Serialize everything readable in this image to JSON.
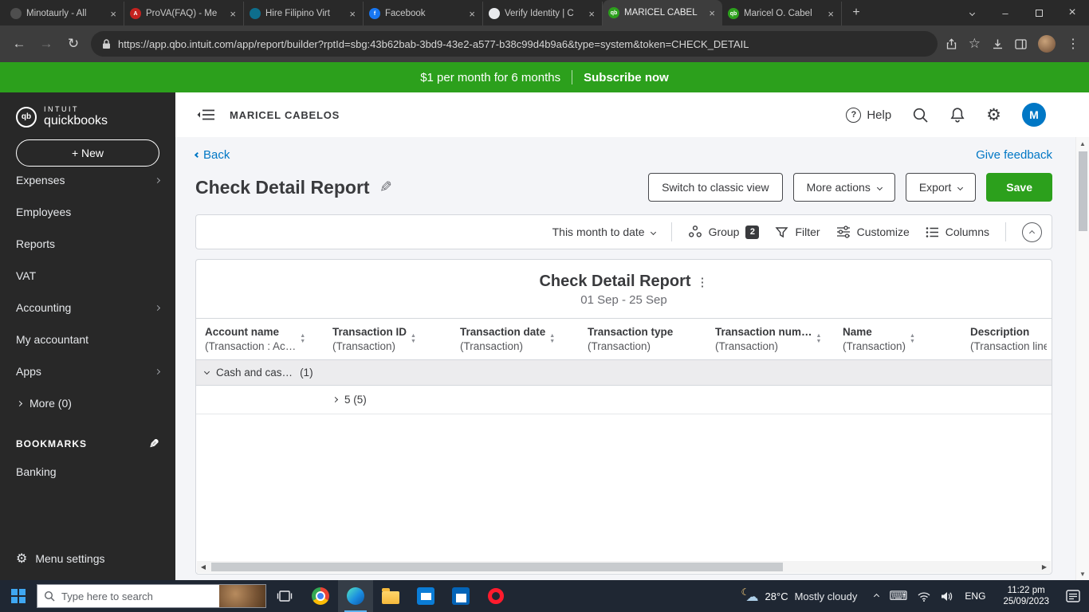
{
  "browser": {
    "tabs": [
      {
        "label": "Minotaurly - All",
        "icon": "minotaurly",
        "icon_letter": "",
        "color": "#4e4e4e"
      },
      {
        "label": "ProVA(FAQ) - Me",
        "icon": "prova",
        "icon_letter": "A",
        "color": "#c5221f"
      },
      {
        "label": "Hire Filipino Virt",
        "icon": "hire-filipino",
        "icon_letter": "",
        "color": "#0e6e8c"
      },
      {
        "label": "Facebook",
        "icon": "facebook",
        "icon_letter": "f",
        "color": "#1877f2"
      },
      {
        "label": "Verify Identity | C",
        "icon": "verify-identity",
        "icon_letter": "",
        "color": "#e8eaed"
      },
      {
        "label": "MARICEL CABEL",
        "icon": "quickbooks",
        "icon_letter": "qb",
        "color": "#2ca01c"
      },
      {
        "label": "Maricel O. Cabel",
        "icon": "quickbooks",
        "icon_letter": "qb",
        "color": "#2ca01c"
      }
    ],
    "url": "https://app.qbo.intuit.com/app/report/builder?rptId=sbg:43b62bab-3bd9-43e2-a577-b38c99d4b9a6&type=system&token=CHECK_DETAIL"
  },
  "banner": {
    "text": "$1 per month for 6 months",
    "cta": "Subscribe now"
  },
  "sidebar": {
    "logo_mark": "qb",
    "logo_top": "INTUIT",
    "logo_bottom": "quickbooks",
    "new_button": "+ New",
    "items": [
      {
        "label": "Expenses",
        "chevron": true
      },
      {
        "label": "Employees",
        "chevron": false
      },
      {
        "label": "Reports",
        "chevron": false
      },
      {
        "label": "VAT",
        "chevron": false
      },
      {
        "label": "Accounting",
        "chevron": true
      },
      {
        "label": "My accountant",
        "chevron": false
      },
      {
        "label": "Apps",
        "chevron": true
      },
      {
        "label": "More (0)",
        "chevron": false
      }
    ],
    "bookmarks_label": "BOOKMARKS",
    "bookmarks": [
      {
        "label": "Banking"
      }
    ],
    "menu_settings": "Menu settings"
  },
  "header": {
    "company": "MARICEL CABELOS",
    "help": "Help",
    "avatar": "M"
  },
  "page": {
    "back": "Back",
    "feedback": "Give feedback",
    "title": "Check Detail Report",
    "actions": {
      "classic": "Switch to classic view",
      "more": "More actions",
      "export": "Export",
      "save": "Save"
    }
  },
  "toolbar": {
    "date_range": "This month to date",
    "group": "Group",
    "group_badge": "2",
    "filter": "Filter",
    "customize": "Customize",
    "columns": "Columns"
  },
  "report": {
    "title": "Check Detail Report",
    "subtitle": "01 Sep - 25 Sep",
    "columns": [
      {
        "name": "Account name",
        "sub": "(Transaction : Ac…",
        "sortable": true
      },
      {
        "name": "Transaction ID",
        "sub": "(Transaction)",
        "sortable": true
      },
      {
        "name": "Transaction date",
        "sub": "(Transaction)",
        "sortable": true
      },
      {
        "name": "Transaction type",
        "sub": "(Transaction)",
        "sortable": false
      },
      {
        "name": "Transaction num…",
        "sub": "(Transaction)",
        "sortable": true
      },
      {
        "name": "Name",
        "sub": "(Transaction)",
        "sortable": true
      },
      {
        "name": "Description",
        "sub": "(Transaction line",
        "sortable": false
      }
    ],
    "group_row": {
      "label": "Cash and cas…",
      "count": "(1)"
    },
    "sub_row": {
      "label": "5 (5)"
    }
  },
  "taskbar": {
    "search_placeholder": "Type here to search",
    "weather_temp": "28°C",
    "weather_desc": "Mostly cloudy",
    "lang": "ENG",
    "time": "11:22 pm",
    "date": "25/09/2023"
  },
  "colors": {
    "accent_green": "#2ca01c",
    "link_blue": "#0077c5"
  },
  "icons": {
    "close": "×",
    "plus": "+",
    "minimize": "–",
    "back": "←",
    "forward": "→",
    "reload": "↻",
    "star": "☆",
    "menu_dots": "⋮",
    "kebab": "⋮",
    "gear": "⚙",
    "question": "?",
    "pencil": "✎",
    "sort_up": "▲",
    "sort_down": "▼",
    "keyboard": "⌨",
    "cloud": "☁",
    "moon": "☾",
    "left_scroll": "◀",
    "right_scroll": "▶",
    "up_scroll": "▲",
    "down_scroll": "▼"
  }
}
